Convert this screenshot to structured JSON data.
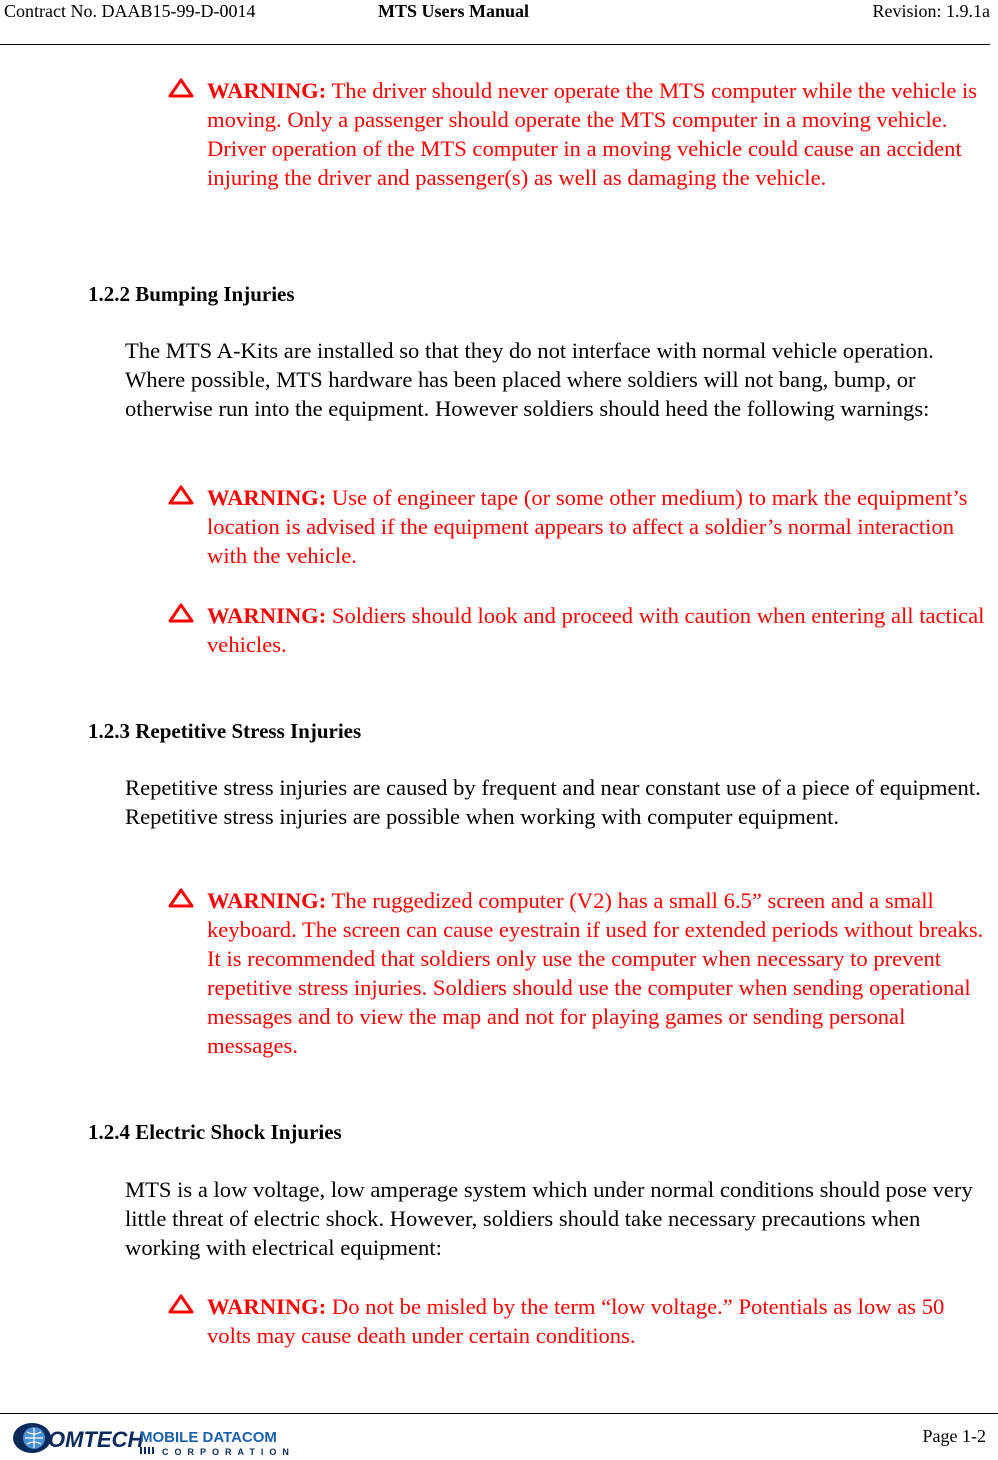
{
  "header": {
    "contract": "Contract No. DAAB15-99-D-0014",
    "title": "MTS Users Manual",
    "revision": "Revision:  1.9.1a"
  },
  "warnings_top": [
    {
      "label": "WARNING:",
      "text": " The driver should never operate the MTS computer while the vehicle is moving.  Only a passenger should operate the MTS computer in a moving vehicle.  Driver operation of the MTS computer in a moving vehicle could cause an accident injuring the driver and passenger(s) as well as damaging the vehicle."
    }
  ],
  "sections": [
    {
      "heading": "1.2.2  Bumping Injuries",
      "body": "The MTS A-Kits are installed so that they do not interface with normal vehicle operation.  Where possible, MTS hardware has been placed where soldiers will not bang, bump, or otherwise run into the equipment.  However soldiers should heed the following warnings:",
      "warnings": [
        {
          "label": "WARNING:",
          "text": "  Use of engineer tape (or some other medium) to mark the equipment’s location is advised if the equipment appears to affect a soldier’s normal interaction with the vehicle."
        },
        {
          "label": "WARNING:",
          "text": "  Soldiers should look and proceed with caution when entering all tactical vehicles."
        }
      ]
    },
    {
      "heading": "1.2.3  Repetitive Stress Injuries",
      "body": "Repetitive stress injuries are caused by frequent and near constant use of a piece of equipment.  Repetitive stress injuries are possible when working with computer equipment.",
      "warnings": [
        {
          "label": "WARNING:",
          "text": "  The ruggedized computer (V2) has a small 6.5” screen and a small keyboard.  The screen can cause eyestrain if used for extended periods without breaks.  It is recommended that soldiers only use the computer when necessary to prevent repetitive stress injuries.  Soldiers should use the computer when sending operational messages and to view the map and not for playing games or sending personal messages."
        }
      ]
    },
    {
      "heading": "1.2.4  Electric Shock Injuries",
      "body": "MTS is a low voltage, low amperage system which under normal conditions should pose very little threat of electric shock.  However, soldiers should take necessary precautions when working with electrical equipment:",
      "warnings": [
        {
          "label": "WARNING:",
          "text": " Do not be misled by the term “low voltage.”  Potentials as low as 50 volts may cause death under certain conditions."
        }
      ]
    }
  ],
  "footer": {
    "logo_main": "OMTECH",
    "logo_brand": "MOBILE DATACOM",
    "logo_sub": "CORPORATION",
    "page": "Page 1-2"
  },
  "colors": {
    "warning": "#ff0000",
    "logo_blue": "#1b5fa8",
    "logo_dark": "#0a2a5a"
  }
}
